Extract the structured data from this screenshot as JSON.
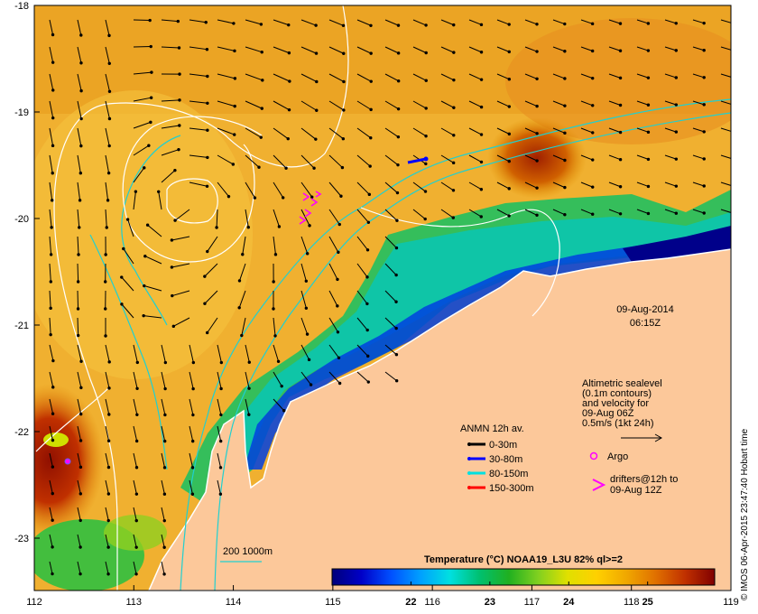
{
  "map": {
    "date": "09-Aug-2014",
    "time": "06:15Z",
    "x_ticks": [
      "112",
      "113",
      "114",
      "115",
      "116",
      "117",
      "118",
      "119"
    ],
    "y_ticks": [
      "-18",
      "-19",
      "-20",
      "-21",
      "-22",
      "-23"
    ],
    "credit": "© IMOS 06-Apr-2015 23:47:40 Hobart time"
  },
  "legend": {
    "anmn_title": "ANMN 12h av.",
    "anmn_items": [
      {
        "label": "0-30m",
        "color": "#000000"
      },
      {
        "label": "30-80m",
        "color": "#0000ff"
      },
      {
        "label": "80-150m",
        "color": "#00e0e0"
      },
      {
        "label": "150-300m",
        "color": "#ff0000"
      }
    ],
    "altimetric_lines": [
      "Altimetric sealevel",
      "(0.1m contours)",
      "and velocity for",
      "09-Aug 06Z",
      "0.5m/s (1kt 24h)"
    ],
    "argo": "Argo",
    "drifters_lines": [
      "drifters@12h to",
      "09-Aug 12Z"
    ],
    "isobath": "200  1000m"
  },
  "colorbar": {
    "title": "Temperature (°C) NOAA19_L3U 82% ql>=2",
    "ticks": [
      "22",
      "23",
      "24",
      "25"
    ],
    "range": [
      21.0,
      25.85
    ],
    "colors": [
      "#00007a",
      "#0000c8",
      "#0050ff",
      "#00a0ff",
      "#00e0e0",
      "#00c070",
      "#20b020",
      "#80d020",
      "#e0e000",
      "#ffd000",
      "#f0a800",
      "#e07000",
      "#c03000",
      "#800000"
    ]
  },
  "colors": {
    "land": "#fcc89a",
    "contour": "#ffffff",
    "isobath": "#20d0d0",
    "argo": "#ff00ff",
    "drifter": "#ff00ff"
  }
}
